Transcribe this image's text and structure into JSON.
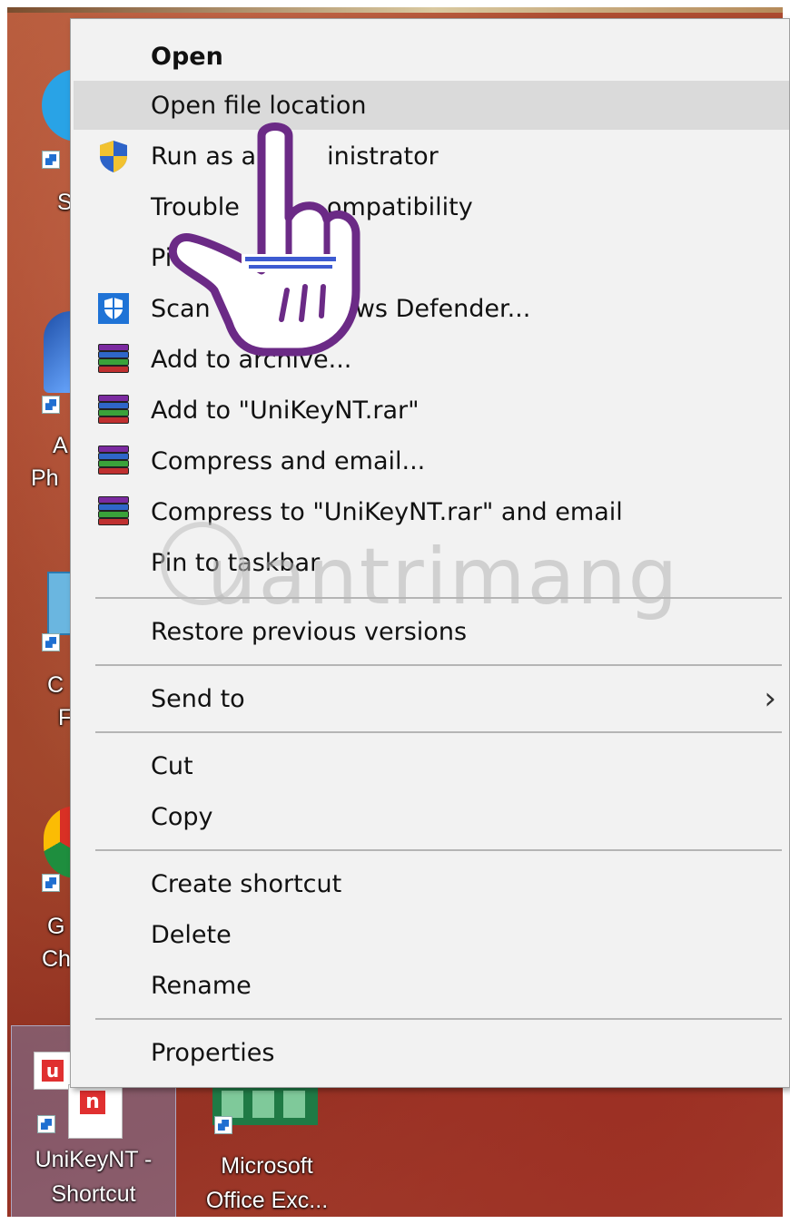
{
  "desktop": {
    "partial_labels": [
      "S",
      "A",
      "Ph",
      "C",
      "F",
      "G",
      "Ch"
    ],
    "icons": [
      {
        "name": "UniKeyNT - Shortcut",
        "line1": "UniKeyNT -",
        "line2": "Shortcut"
      },
      {
        "name": "Microsoft Office Excel",
        "line1": "Microsoft",
        "line2": "Office Exc..."
      }
    ]
  },
  "menu": {
    "items": [
      {
        "label": "Open",
        "bold": true
      },
      {
        "label": "Open file location",
        "highlighted": true
      },
      {
        "label": "Run as administrator",
        "visible": "Run as a",
        "visible_tail": "inistrator",
        "icon": "shield-uac-icon"
      },
      {
        "label": "Troubleshoot compatibility",
        "visible": "Trouble",
        "visible_tail": "ompatibility"
      },
      {
        "label": "Pin to Start",
        "visible": "Pi"
      },
      {
        "label": "Scan with Windows Defender...",
        "visible": "Scan w",
        "visible_tail": "ows Defender...",
        "icon": "windows-defender-icon"
      },
      {
        "label": "Add to archive...",
        "icon": "winrar-icon"
      },
      {
        "label": "Add to \"UniKeyNT.rar\"",
        "icon": "winrar-icon"
      },
      {
        "label": "Compress and email...",
        "icon": "winrar-icon"
      },
      {
        "label": "Compress to \"UniKeyNT.rar\" and email",
        "icon": "winrar-icon"
      },
      {
        "label": "Pin to taskbar"
      },
      {
        "label": "Restore previous versions"
      },
      {
        "label": "Send to",
        "submenu": true
      },
      {
        "label": "Cut"
      },
      {
        "label": "Copy"
      },
      {
        "label": "Create shortcut"
      },
      {
        "label": "Delete"
      },
      {
        "label": "Rename"
      },
      {
        "label": "Properties"
      }
    ]
  },
  "watermark": {
    "text": "uantrimang"
  },
  "colors": {
    "menu_bg": "#f2f2f2",
    "hover_bg": "#dadada",
    "separator": "#b5b5b5",
    "cursor_outline": "#6b2a86"
  }
}
